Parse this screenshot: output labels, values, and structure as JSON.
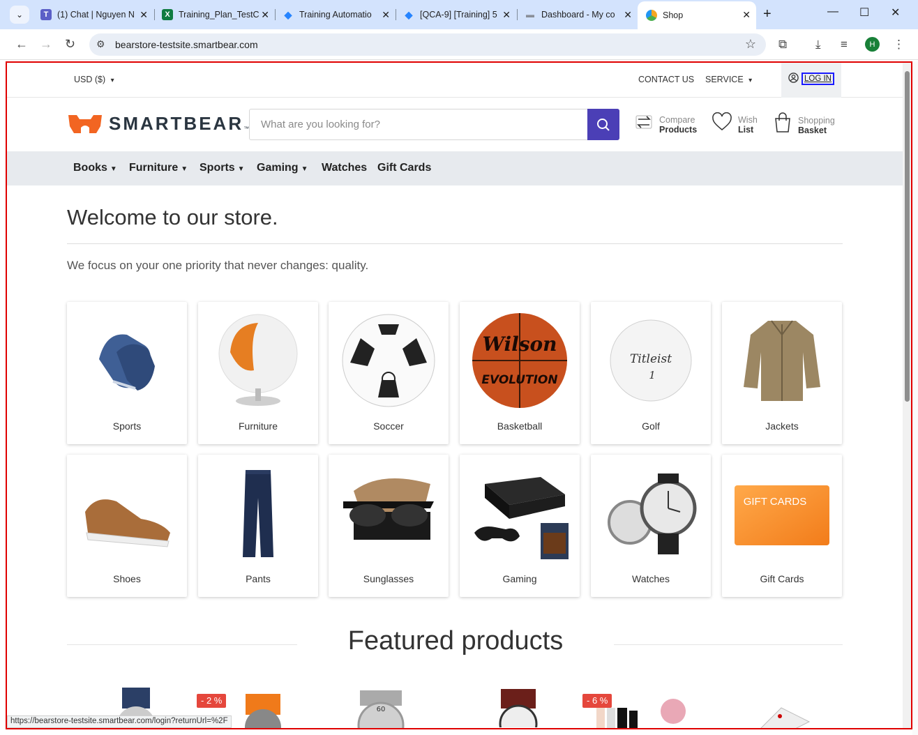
{
  "browser": {
    "tabs": [
      {
        "title": "(1) Chat | Nguyen N",
        "favicon": "teams-icon",
        "color": "#5b5fc7"
      },
      {
        "title": "Training_Plan_TestC",
        "favicon": "excel-icon",
        "color": "#107c41"
      },
      {
        "title": "Training Automatio",
        "favicon": "jira-icon",
        "color": "#2684ff"
      },
      {
        "title": "[QCA-9] [Training] 5",
        "favicon": "jira-icon",
        "color": "#2684ff"
      },
      {
        "title": "Dashboard - My co",
        "favicon": "dashboard-icon",
        "color": "#8a8f99"
      },
      {
        "title": "Shop",
        "favicon": "shop-icon",
        "color": "#f5a623"
      }
    ],
    "url": "bearstore-testsite.smartbear.com",
    "profile_initial": "H",
    "status_url": "https://bearstore-testsite.smartbear.com/login?returnUrl=%2F"
  },
  "topbar": {
    "currency": "USD  ($)",
    "contact": "CONTACT US",
    "service": "SERVICE",
    "login": "LOG IN"
  },
  "brand": {
    "logo_text": "SMARTBEAR",
    "logo_tm": "™"
  },
  "search": {
    "placeholder": "What are you looking for?"
  },
  "utils": {
    "compare": {
      "line1": "Compare",
      "line2": "Products"
    },
    "wish": {
      "line1": "Wish",
      "line2": "List"
    },
    "basket": {
      "line1": "Shopping",
      "line2": "Basket"
    }
  },
  "menu": [
    {
      "label": "Books",
      "dropdown": true
    },
    {
      "label": "Furniture",
      "dropdown": true
    },
    {
      "label": "Sports",
      "dropdown": true
    },
    {
      "label": "Gaming",
      "dropdown": true
    },
    {
      "label": "Watches",
      "dropdown": false
    },
    {
      "label": "Gift Cards",
      "dropdown": false
    }
  ],
  "hero": {
    "title": "Welcome to our store.",
    "subtitle": "We focus on your one priority that never changes: quality."
  },
  "categories": [
    {
      "label": "Sports"
    },
    {
      "label": "Furniture"
    },
    {
      "label": "Soccer"
    },
    {
      "label": "Basketball"
    },
    {
      "label": "Golf"
    },
    {
      "label": "Jackets"
    },
    {
      "label": "Shoes"
    },
    {
      "label": "Pants"
    },
    {
      "label": "Sunglasses"
    },
    {
      "label": "Gaming"
    },
    {
      "label": "Watches"
    },
    {
      "label": "Gift Cards"
    }
  ],
  "product_images": {
    "basketball_brand": "Wilson",
    "basketball_model": "EVOLUTION",
    "golf_brand": "Titleist",
    "golf_number": "1",
    "giftcard_text": "GIFT CARDS"
  },
  "featured": {
    "title": "Featured products",
    "badges": [
      "- 2 %",
      "- 6 %"
    ]
  },
  "colors": {
    "accent": "#4b3fb6",
    "logo_orange": "#f26522",
    "sale_badge": "#e5473c",
    "frame_red": "#e00000"
  }
}
